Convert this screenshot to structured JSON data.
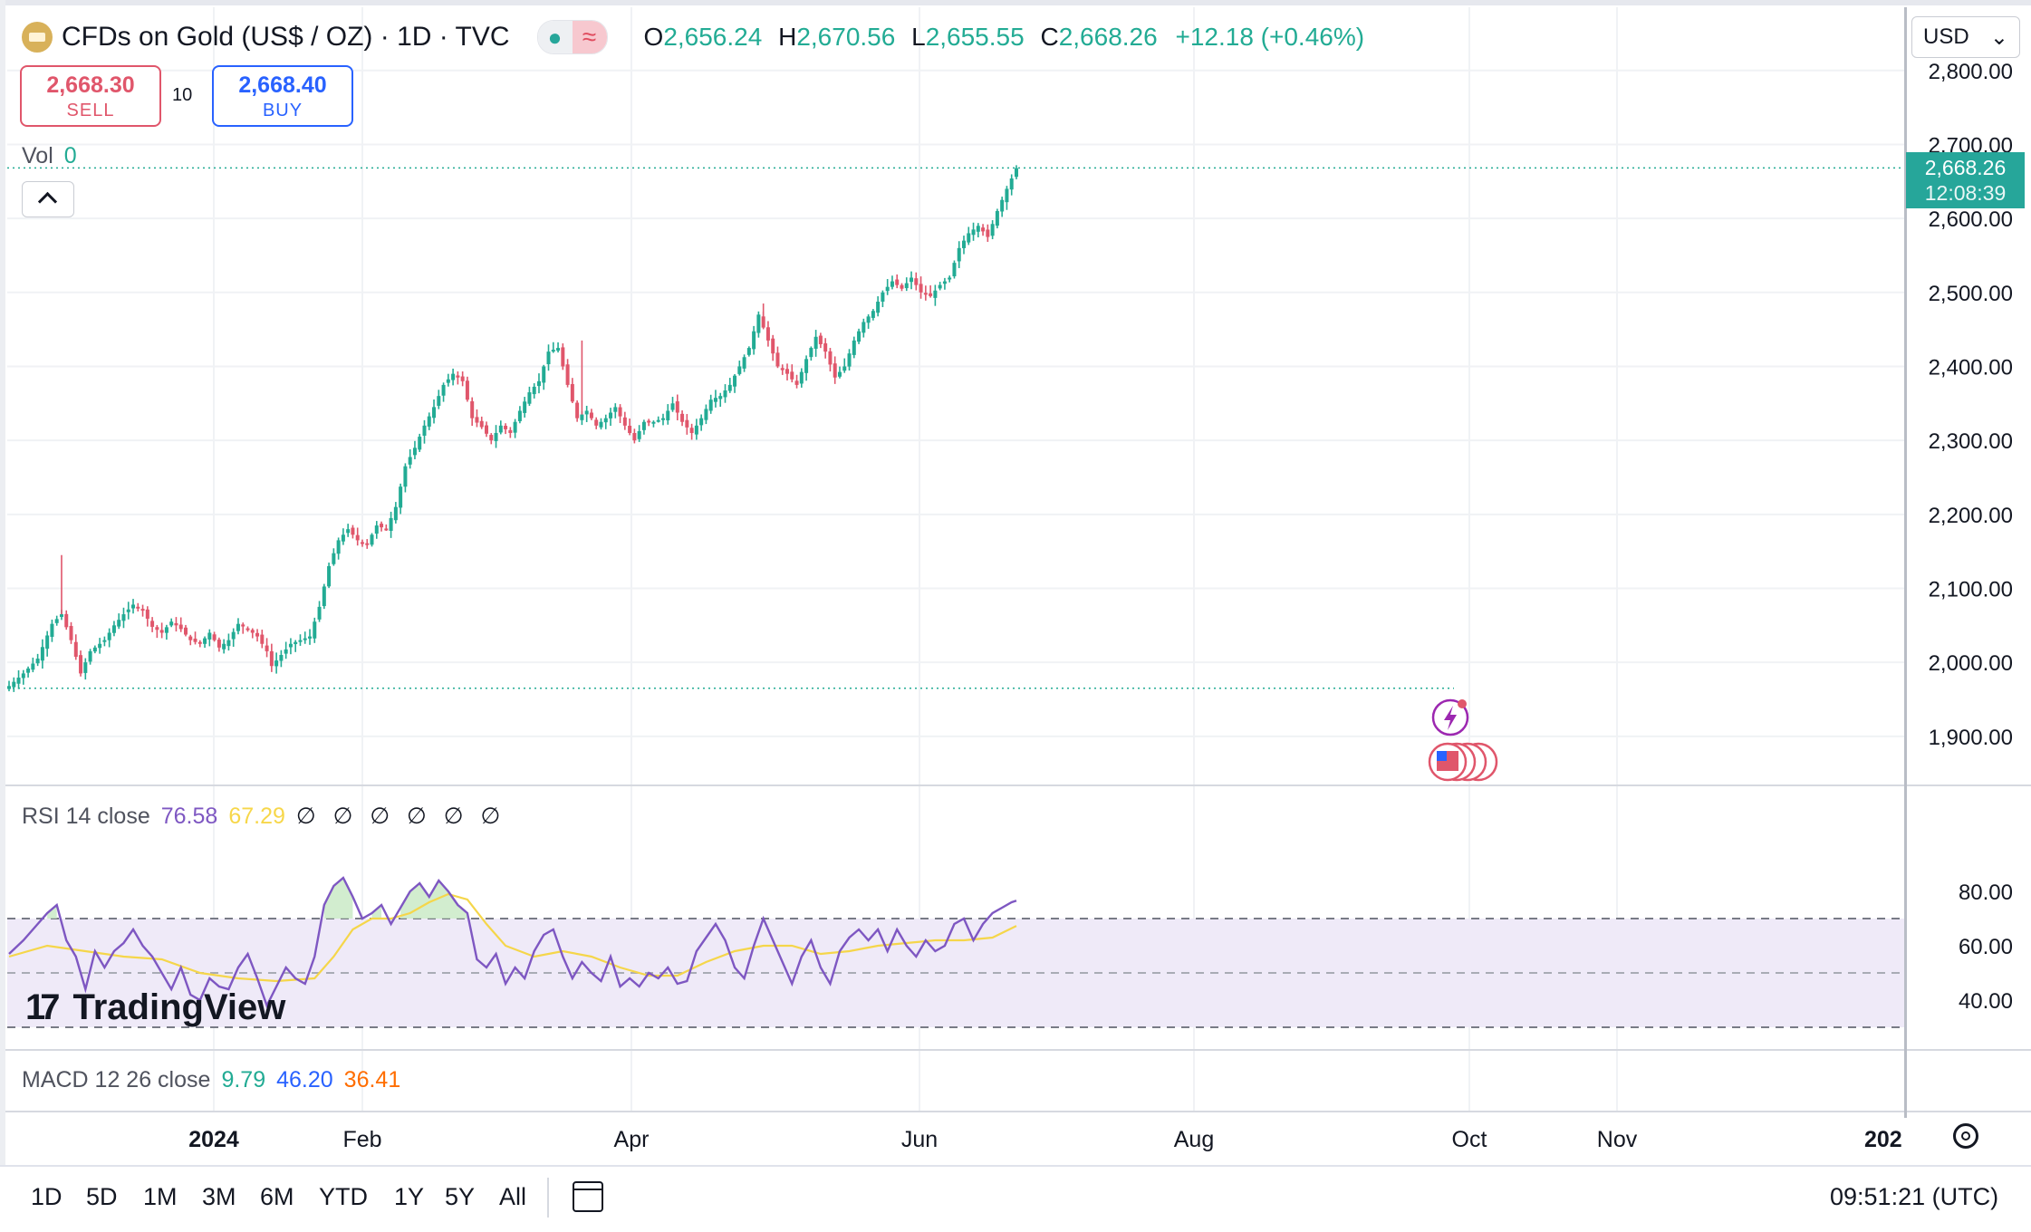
{
  "header": {
    "symbol": "CFDs on Gold (US$ / OZ) · 1D · TVC",
    "ohlc": {
      "o_label": "O",
      "o": "2,656.24",
      "h_label": "H",
      "h": "2,670.56",
      "l_label": "L",
      "l": "2,655.55",
      "c_label": "C",
      "c": "2,668.26",
      "change": "+12.18 (+0.46%)"
    }
  },
  "trade": {
    "sell_price": "2,668.30",
    "sell_label": "SELL",
    "spread": "10",
    "buy_price": "2,668.40",
    "buy_label": "BUY"
  },
  "volume": {
    "label": "Vol",
    "value": "0"
  },
  "currency": {
    "label": "USD",
    "chevron": "⌄"
  },
  "price_tag": {
    "price": "2,668.26",
    "countdown": "12:08:39"
  },
  "rsi": {
    "label": "RSI 14 close",
    "value": "76.58",
    "ma_value": "67.29",
    "na_values": "∅ ∅ ∅ ∅ ∅ ∅"
  },
  "macd": {
    "label": "MACD 12 26 close",
    "hist": "9.79",
    "macd": "46.20",
    "signal": "36.41"
  },
  "logo_text": "TradingView",
  "timeframes": [
    "1D",
    "5D",
    "1M",
    "3M",
    "6M",
    "YTD",
    "1Y",
    "5Y",
    "All"
  ],
  "clock": "09:51:21 (UTC)",
  "colors": {
    "up": "#22ab94",
    "down": "#e0566b",
    "rsi": "#7e57c2",
    "rsi_ma": "#f5d64a",
    "rsi_band": "#efeaf8"
  },
  "chart_data": [
    {
      "type": "candlestick",
      "title": "CFDs on Gold (US$ / OZ) · 1D · TVC",
      "y_ticks": [
        "1,900.00",
        "2,000.00",
        "2,100.00",
        "2,200.00",
        "2,300.00",
        "2,400.00",
        "2,500.00",
        "2,600.00",
        "2,700.00",
        "2,800.00"
      ],
      "y_tick_values": [
        1900,
        2000,
        2100,
        2200,
        2300,
        2400,
        2500,
        2600,
        2700,
        2800
      ],
      "ylim": [
        1830,
        2810
      ],
      "x_ticks": [
        "2024",
        "Feb",
        "Apr",
        "Jun",
        "Aug",
        "Oct",
        "Nov",
        "202"
      ],
      "last_price": 2668.26,
      "reference_low": 1965,
      "series": [
        {
          "name": "Close",
          "points": [
            [
              0,
              1968
            ],
            [
              3,
              1985
            ],
            [
              6,
              2005
            ],
            [
              9,
              2052
            ],
            [
              11,
              2065
            ],
            [
              13,
              2030
            ],
            [
              15,
              1985
            ],
            [
              17,
              2015
            ],
            [
              20,
              2030
            ],
            [
              22,
              2050
            ],
            [
              24,
              2065
            ],
            [
              26,
              2078
            ],
            [
              28,
              2070
            ],
            [
              30,
              2048
            ],
            [
              32,
              2040
            ],
            [
              34,
              2055
            ],
            [
              36,
              2045
            ],
            [
              38,
              2030
            ],
            [
              40,
              2025
            ],
            [
              42,
              2040
            ],
            [
              44,
              2020
            ],
            [
              46,
              2030
            ],
            [
              48,
              2052
            ],
            [
              50,
              2045
            ],
            [
              52,
              2035
            ],
            [
              54,
              2015
            ],
            [
              55,
              1995
            ],
            [
              57,
              2010
            ],
            [
              59,
              2025
            ],
            [
              61,
              2030
            ],
            [
              63,
              2035
            ],
            [
              65,
              2075
            ],
            [
              67,
              2130
            ],
            [
              69,
              2165
            ],
            [
              71,
              2180
            ],
            [
              73,
              2165
            ],
            [
              75,
              2160
            ],
            [
              77,
              2185
            ],
            [
              79,
              2180
            ],
            [
              81,
              2210
            ],
            [
              83,
              2265
            ],
            [
              85,
              2290
            ],
            [
              87,
              2320
            ],
            [
              89,
              2345
            ],
            [
              91,
              2375
            ],
            [
              93,
              2390
            ],
            [
              95,
              2380
            ],
            [
              97,
              2330
            ],
            [
              99,
              2318
            ],
            [
              101,
              2300
            ],
            [
              103,
              2320
            ],
            [
              105,
              2310
            ],
            [
              107,
              2340
            ],
            [
              109,
              2365
            ],
            [
              111,
              2380
            ],
            [
              113,
              2420
            ],
            [
              115,
              2425
            ],
            [
              117,
              2375
            ],
            [
              119,
              2330
            ],
            [
              121,
              2340
            ],
            [
              123,
              2320
            ],
            [
              125,
              2330
            ],
            [
              127,
              2345
            ],
            [
              129,
              2320
            ],
            [
              131,
              2300
            ],
            [
              133,
              2325
            ],
            [
              135,
              2325
            ],
            [
              137,
              2330
            ],
            [
              139,
              2350
            ],
            [
              141,
              2325
            ],
            [
              143,
              2310
            ],
            [
              145,
              2330
            ],
            [
              147,
              2355
            ],
            [
              149,
              2360
            ],
            [
              151,
              2375
            ],
            [
              153,
              2400
            ],
            [
              155,
              2425
            ],
            [
              157,
              2470
            ],
            [
              159,
              2435
            ],
            [
              161,
              2400
            ],
            [
              163,
              2390
            ],
            [
              165,
              2375
            ],
            [
              167,
              2410
            ],
            [
              169,
              2440
            ],
            [
              171,
              2420
            ],
            [
              173,
              2385
            ],
            [
              175,
              2400
            ],
            [
              177,
              2435
            ],
            [
              179,
              2460
            ],
            [
              181,
              2475
            ],
            [
              183,
              2500
            ],
            [
              185,
              2515
            ],
            [
              187,
              2505
            ],
            [
              189,
              2520
            ],
            [
              191,
              2500
            ],
            [
              193,
              2495
            ],
            [
              195,
              2510
            ],
            [
              197,
              2520
            ],
            [
              199,
              2560
            ],
            [
              201,
              2580
            ],
            [
              203,
              2590
            ],
            [
              205,
              2575
            ],
            [
              207,
              2610
            ],
            [
              209,
              2640
            ],
            [
              211,
              2668
            ]
          ]
        },
        {
          "name": "High",
          "points": [
            [
              11,
              2145
            ],
            [
              120,
              2435
            ],
            [
              158,
              2485
            ]
          ]
        }
      ]
    },
    {
      "type": "line",
      "title": "RSI 14 close",
      "y_ticks": [
        "40.00",
        "60.00",
        "80.00"
      ],
      "y_tick_values": [
        40,
        60,
        80
      ],
      "ylim": [
        28,
        88
      ],
      "band": [
        30,
        70
      ],
      "midline": 50,
      "series": [
        {
          "name": "RSI",
          "points": [
            [
              0,
              57
            ],
            [
              3,
              62
            ],
            [
              6,
              68
            ],
            [
              8,
              72
            ],
            [
              10,
              75
            ],
            [
              12,
              62
            ],
            [
              14,
              56
            ],
            [
              16,
              44
            ],
            [
              18,
              58
            ],
            [
              20,
              52
            ],
            [
              22,
              58
            ],
            [
              24,
              61
            ],
            [
              26,
              66
            ],
            [
              28,
              60
            ],
            [
              30,
              56
            ],
            [
              32,
              50
            ],
            [
              34,
              44
            ],
            [
              36,
              52
            ],
            [
              38,
              42
            ],
            [
              40,
              40
            ],
            [
              42,
              48
            ],
            [
              44,
              45
            ],
            [
              46,
              44
            ],
            [
              48,
              52
            ],
            [
              50,
              57
            ],
            [
              52,
              48
            ],
            [
              54,
              38
            ],
            [
              56,
              45
            ],
            [
              58,
              52
            ],
            [
              60,
              48
            ],
            [
              62,
              46
            ],
            [
              64,
              56
            ],
            [
              66,
              75
            ],
            [
              68,
              82
            ],
            [
              70,
              85
            ],
            [
              72,
              78
            ],
            [
              74,
              70
            ],
            [
              76,
              72
            ],
            [
              78,
              75
            ],
            [
              80,
              68
            ],
            [
              82,
              74
            ],
            [
              84,
              80
            ],
            [
              86,
              83
            ],
            [
              88,
              78
            ],
            [
              90,
              84
            ],
            [
              92,
              80
            ],
            [
              94,
              75
            ],
            [
              96,
              72
            ],
            [
              98,
              55
            ],
            [
              100,
              52
            ],
            [
              102,
              57
            ],
            [
              104,
              46
            ],
            [
              106,
              52
            ],
            [
              108,
              48
            ],
            [
              110,
              58
            ],
            [
              112,
              64
            ],
            [
              114,
              66
            ],
            [
              116,
              56
            ],
            [
              118,
              48
            ],
            [
              120,
              54
            ],
            [
              122,
              50
            ],
            [
              124,
              47
            ],
            [
              126,
              56
            ],
            [
              128,
              45
            ],
            [
              130,
              48
            ],
            [
              132,
              45
            ],
            [
              134,
              50
            ],
            [
              136,
              48
            ],
            [
              138,
              52
            ],
            [
              140,
              46
            ],
            [
              142,
              47
            ],
            [
              144,
              58
            ],
            [
              146,
              63
            ],
            [
              148,
              68
            ],
            [
              150,
              62
            ],
            [
              152,
              52
            ],
            [
              154,
              48
            ],
            [
              156,
              60
            ],
            [
              158,
              70
            ],
            [
              160,
              62
            ],
            [
              162,
              54
            ],
            [
              164,
              46
            ],
            [
              166,
              56
            ],
            [
              168,
              62
            ],
            [
              170,
              52
            ],
            [
              172,
              46
            ],
            [
              174,
              58
            ],
            [
              176,
              63
            ],
            [
              178,
              66
            ],
            [
              180,
              62
            ],
            [
              182,
              66
            ],
            [
              184,
              58
            ],
            [
              186,
              66
            ],
            [
              188,
              60
            ],
            [
              190,
              56
            ],
            [
              192,
              62
            ],
            [
              194,
              58
            ],
            [
              196,
              60
            ],
            [
              198,
              68
            ],
            [
              200,
              70
            ],
            [
              202,
              62
            ],
            [
              204,
              68
            ],
            [
              206,
              72
            ],
            [
              208,
              74
            ],
            [
              210,
              76
            ],
            [
              211,
              76.58
            ]
          ]
        },
        {
          "name": "RSI-based MA",
          "points": [
            [
              0,
              56
            ],
            [
              8,
              60
            ],
            [
              16,
              58
            ],
            [
              24,
              56
            ],
            [
              32,
              55
            ],
            [
              40,
              50
            ],
            [
              48,
              48
            ],
            [
              56,
              47
            ],
            [
              64,
              48
            ],
            [
              68,
              56
            ],
            [
              72,
              66
            ],
            [
              76,
              70
            ],
            [
              80,
              70
            ],
            [
              84,
              72
            ],
            [
              88,
              76
            ],
            [
              92,
              79
            ],
            [
              96,
              77
            ],
            [
              100,
              68
            ],
            [
              104,
              60
            ],
            [
              110,
              56
            ],
            [
              116,
              58
            ],
            [
              122,
              56
            ],
            [
              128,
              52
            ],
            [
              134,
              49
            ],
            [
              140,
              49
            ],
            [
              146,
              54
            ],
            [
              152,
              58
            ],
            [
              158,
              60
            ],
            [
              164,
              60
            ],
            [
              170,
              57
            ],
            [
              176,
              58
            ],
            [
              182,
              60
            ],
            [
              188,
              61
            ],
            [
              194,
              62
            ],
            [
              200,
              62
            ],
            [
              206,
              63
            ],
            [
              211,
              67.29
            ]
          ]
        }
      ]
    },
    {
      "type": "line",
      "title": "MACD 12 26 close",
      "series": [
        {
          "name": "Histogram",
          "values": [
            9.79
          ]
        },
        {
          "name": "MACD",
          "values": [
            46.2
          ]
        },
        {
          "name": "Signal",
          "values": [
            36.41
          ]
        }
      ]
    }
  ]
}
